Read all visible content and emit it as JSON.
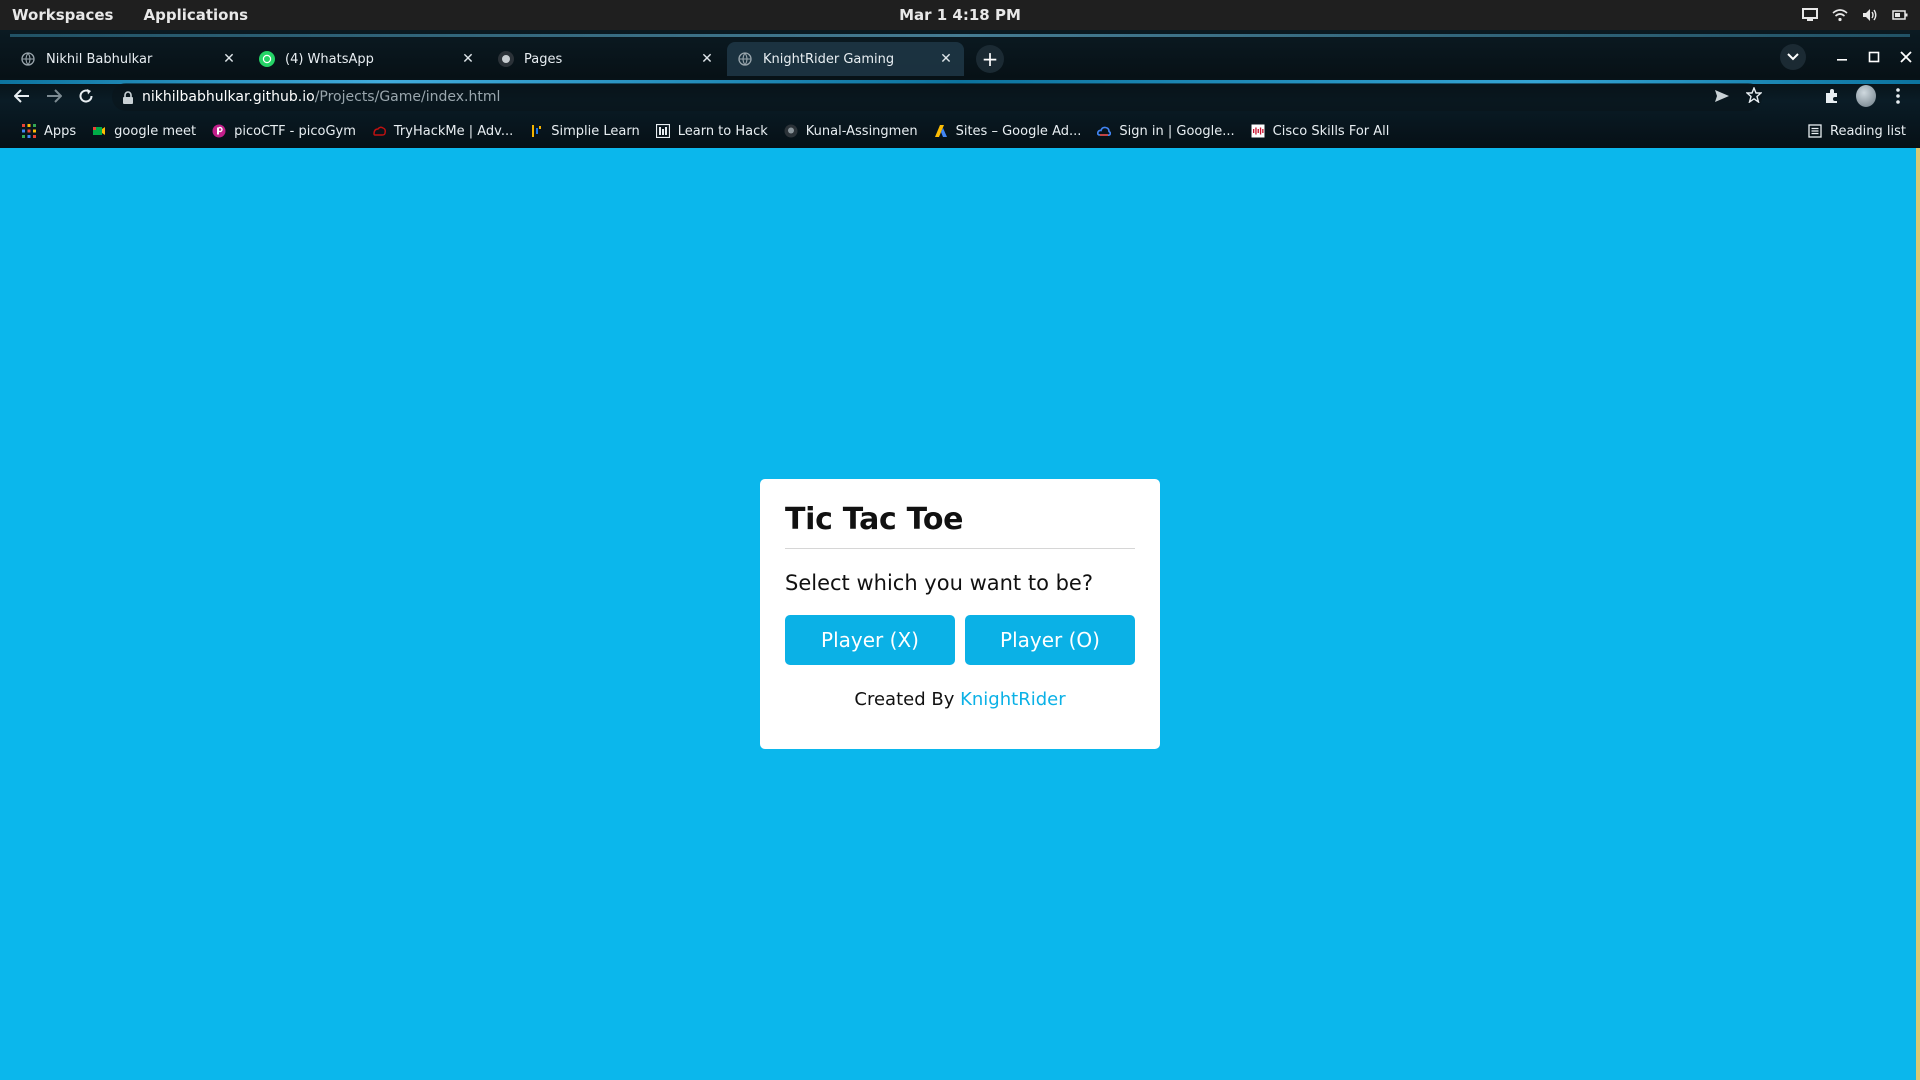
{
  "system": {
    "left_items": [
      "Workspaces",
      "Applications"
    ],
    "clock": "Mar 1   4:18 PM"
  },
  "tabs": [
    {
      "title": "Nikhil Babhulkar",
      "active": false
    },
    {
      "title": "(4) WhatsApp",
      "active": false
    },
    {
      "title": "Pages",
      "active": false
    },
    {
      "title": "KnightRider Gaming",
      "active": true
    }
  ],
  "address": {
    "domain": "nikhilbabhulkar.github.io",
    "path": "/Projects/Game/index.html"
  },
  "bookmarks": [
    {
      "label": "Apps",
      "icon": "apps-grid-icon"
    },
    {
      "label": "google meet",
      "icon": "google-meet-icon"
    },
    {
      "label": "picoCTF - picoGym",
      "icon": "picoctf-icon"
    },
    {
      "label": "TryHackMe | Adv...",
      "icon": "tryhackme-icon"
    },
    {
      "label": "Simplie Learn",
      "icon": "simplilearn-icon"
    },
    {
      "label": "Learn to Hack",
      "icon": "learn-to-hack-icon"
    },
    {
      "label": "Kunal-Assingmen",
      "icon": "github-icon"
    },
    {
      "label": "Sites – Google Ad...",
      "icon": "google-ads-icon"
    },
    {
      "label": "Sign in | Google...",
      "icon": "google-cloud-icon"
    },
    {
      "label": "Cisco Skills For All",
      "icon": "cisco-icon"
    }
  ],
  "reading_list": "Reading list",
  "game": {
    "title": "Tic Tac Toe",
    "question": "Select which you want to be?",
    "player_x": "Player (X)",
    "player_o": "Player (O)",
    "credit_prefix": "Created By",
    "credit_name": "KnightRider"
  },
  "colors": {
    "page_background": "#0bb7ec",
    "button": "#0bb1e6",
    "link": "#0bb1e6"
  }
}
